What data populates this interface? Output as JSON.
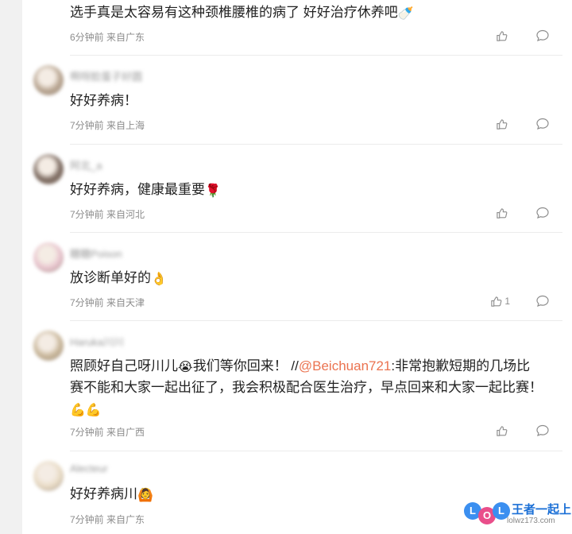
{
  "comments": [
    {
      "username": "",
      "text": "选手真是太容易有这种颈椎腰椎的病了 好好治疗休养吧",
      "emoji": "🍼",
      "time": "6分钟前",
      "location": "来自广东",
      "likes": "",
      "avatar_color": "#d8d0c6"
    },
    {
      "username": "啊呀脸蛋子好圆",
      "text": "好好养病！",
      "emoji": "",
      "time": "7分钟前",
      "location": "来自上海",
      "likes": "",
      "avatar_color": "#b9a692"
    },
    {
      "username": "阿北_a",
      "text": "好好养病，健康最重要",
      "emoji": "🌹",
      "time": "7分钟前",
      "location": "来自河北",
      "likes": "",
      "avatar_color": "#7c6a60"
    },
    {
      "username": "糖糖Poison",
      "text": "放诊断单好的",
      "emoji": "👌",
      "time": "7分钟前",
      "location": "来自天津",
      "likes": "1",
      "avatar_color": "#e9c5cf"
    },
    {
      "username": "Haruka川川",
      "text_before": "照顾好自己呀川儿",
      "emoji": "😭",
      "text_mid": "我们等你回来！ //",
      "mention": "@Beichuan721",
      "text_after": ":非常抱歉短期的几场比赛不能和大家一起出征了，我会积极配合医生治疗，早点回来和大家一起比赛！",
      "emoji_end": "💪💪",
      "time": "7分钟前",
      "location": "来自广西",
      "likes": "",
      "avatar_color": "#c9b79a"
    },
    {
      "username": "Alecteur",
      "text": "好好养病川",
      "emoji": "🙆",
      "time": "7分钟前",
      "location": "来自广东",
      "likes": "",
      "avatar_color": "#e9dcc6"
    }
  ],
  "watermark": {
    "logo": "LOL",
    "title": "王者一起上",
    "site": "lolwz173.com"
  }
}
